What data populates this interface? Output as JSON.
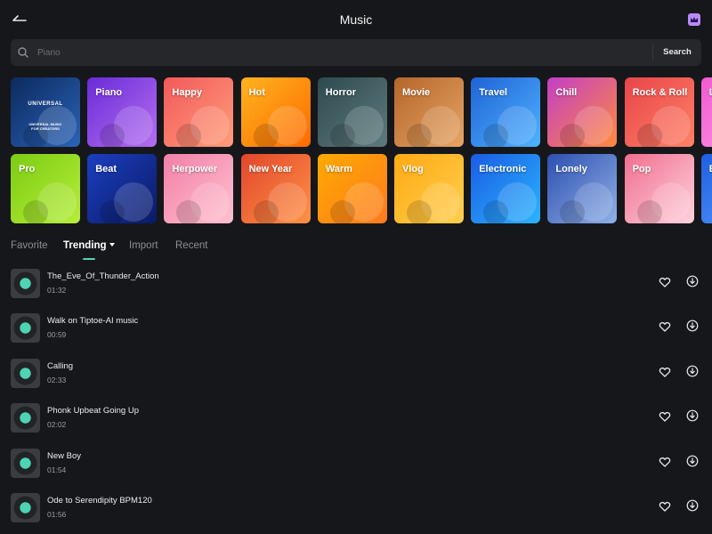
{
  "header": {
    "title": "Music",
    "back_icon": "back-arrow-icon",
    "premium_icon": "crown-icon",
    "premium_color": "#b88af7"
  },
  "search": {
    "placeholder": "Piano",
    "value": "",
    "button_label": "Search"
  },
  "genres": [
    {
      "label": "",
      "logo": "UNIVERSAL",
      "subtitle": [
        "UNIVERSAL MUSIC",
        "FOR CREATORS"
      ],
      "colors": [
        "#0c2a5e",
        "#2a63b8"
      ]
    },
    {
      "label": "Piano",
      "colors": [
        "#6a2bd8",
        "#b46ff0"
      ]
    },
    {
      "label": "Happy",
      "colors": [
        "#f2595b",
        "#ff9d7a"
      ]
    },
    {
      "label": "Hot",
      "colors": [
        "#ffb41f",
        "#ff6a00"
      ]
    },
    {
      "label": "Horror",
      "colors": [
        "#2d4a4f",
        "#5f7a7d"
      ]
    },
    {
      "label": "Movie",
      "colors": [
        "#b5652b",
        "#e6a564"
      ]
    },
    {
      "label": "Travel",
      "colors": [
        "#1f63d6",
        "#4fb2ff"
      ]
    },
    {
      "label": "Chill",
      "colors": [
        "#c23fc6",
        "#ff8a3d"
      ]
    },
    {
      "label": "Rock & Roll",
      "colors": [
        "#e8454a",
        "#ff8066"
      ]
    },
    {
      "label": "Lo-fi",
      "colors": [
        "#f05ad0",
        "#ff9be7"
      ]
    },
    {
      "label": "Pro",
      "colors": [
        "#7ccb12",
        "#b6ee3b"
      ]
    },
    {
      "label": "Beat",
      "colors": [
        "#1c3fc0",
        "#0a1a66"
      ]
    },
    {
      "label": "Herpower",
      "colors": [
        "#f27fa8",
        "#ffc1cf"
      ]
    },
    {
      "label": "New Year",
      "colors": [
        "#e2462c",
        "#ff9246"
      ]
    },
    {
      "label": "Warm",
      "colors": [
        "#ffaa00",
        "#ff7a1f"
      ]
    },
    {
      "label": "Vlog",
      "colors": [
        "#ffa912",
        "#ffcf4f"
      ]
    },
    {
      "label": "Electronic",
      "colors": [
        "#1a5ce3",
        "#2bb4ff"
      ]
    },
    {
      "label": "Lonely",
      "colors": [
        "#2d4fb0",
        "#8fb0e6"
      ]
    },
    {
      "label": "Pop",
      "colors": [
        "#f06f8f",
        "#ffd1dc"
      ]
    },
    {
      "label": "Blues",
      "colors": [
        "#1f5fe0",
        "#5a9cff"
      ]
    }
  ],
  "tabs": [
    {
      "label": "Favorite",
      "active": false
    },
    {
      "label": "Trending",
      "active": true
    },
    {
      "label": "Import",
      "active": false
    },
    {
      "label": "Recent",
      "active": false
    }
  ],
  "tracks": [
    {
      "title": "The_Eve_Of_Thunder_Action",
      "duration": "01:32"
    },
    {
      "title": "Walk on Tiptoe-AI music",
      "duration": "00:59"
    },
    {
      "title": "Calling",
      "duration": "02:33"
    },
    {
      "title": "Phonk Upbeat Going Up",
      "duration": "02:02"
    },
    {
      "title": "New Boy",
      "duration": "01:54"
    },
    {
      "title": "Ode to Serendipity BPM120",
      "duration": "01:56"
    }
  ],
  "colors": {
    "background": "#16171a",
    "search_bg": "#26272b",
    "accent": "#4fd4b3",
    "tab_inactive": "#8d8f96"
  }
}
